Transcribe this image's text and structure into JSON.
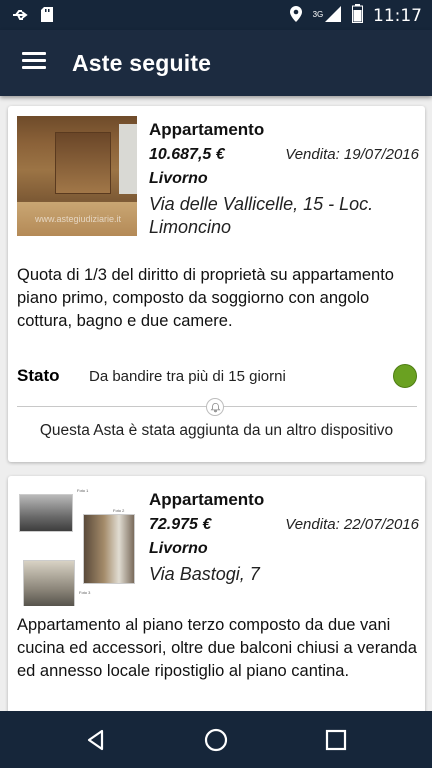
{
  "status_bar": {
    "time": "11:17",
    "network": "3G",
    "icons": [
      "usb-icon",
      "sd-card-icon",
      "location-icon",
      "signal-icon",
      "battery-icon"
    ]
  },
  "app_bar": {
    "title": "Aste seguite",
    "menu_icon": "hamburger-menu-icon"
  },
  "listings": [
    {
      "type": "Appartamento",
      "price": "10.687,5 €",
      "sale_date": "Vendita: 19/07/2016",
      "city": "Livorno",
      "address": "Via delle Vallicelle, 15 - Loc. Limoncino",
      "description": "Quota di 1/3 del diritto di proprietà su appartamento piano primo, composto da soggiorno con angolo cottura, bagno e due camere.",
      "stato_label": "Stato",
      "stato_text": "Da bandire tra più di 15 giorni",
      "stato_color": "#6aa121",
      "added_note": "Questa Asta è stata aggiunta da un altro dispositivo",
      "photo_watermark": "www.astegiudiziarie.it"
    },
    {
      "type": "Appartamento",
      "price": "72.975 €",
      "sale_date": "Vendita: 22/07/2016",
      "city": "Livorno",
      "address": "Via Bastogi, 7",
      "description": "Appartamento al piano terzo composto da due vani cucina ed accessori, oltre due balconi chiusi a veranda ed annesso locale ripostiglio al piano cantina.",
      "photo_labels": [
        "Foto 1",
        "Foto 2",
        "Foto 3"
      ]
    }
  ],
  "nav_bar": {
    "icons": [
      "back-icon",
      "home-icon",
      "recent-apps-icon"
    ]
  },
  "colors": {
    "app_bar": "#1c2b40",
    "status_bar": "#16263a",
    "background": "#eeeeee",
    "status_ok": "#6aa121"
  }
}
